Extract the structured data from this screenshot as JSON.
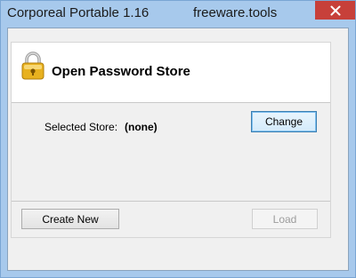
{
  "window": {
    "title": "Corporeal Portable 1.16",
    "title_extra": "freeware.tools"
  },
  "header": {
    "title": "Open Password Store",
    "icon": "lock-icon"
  },
  "store": {
    "label": "Selected Store:",
    "value": "(none)"
  },
  "buttons": {
    "change_label": "Change",
    "create_new_label": "Create New",
    "load_label": "Load",
    "load_enabled": false
  },
  "colors": {
    "window_frame": "#a7c9ec",
    "close_button": "#c7403a",
    "client_background": "#f0f0f0",
    "lock_body": "#e8b11f",
    "focus_border": "#3c7fb1"
  }
}
